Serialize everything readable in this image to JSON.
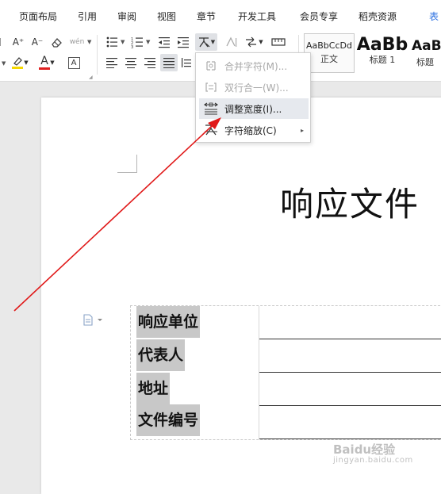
{
  "menu_tabs": [
    "页面布局",
    "引用",
    "审阅",
    "视图",
    "章节",
    "开发工具",
    "会员专享",
    "稻壳资源",
    "表"
  ],
  "ribbon": {
    "font_size_up": "A⁺",
    "font_size_down": "A⁻",
    "phonetic": "wén",
    "font_color_letter": "A",
    "char_border_letter": "A",
    "highlight_color": "#f5d800",
    "font_color": "#e02020",
    "styles": [
      {
        "sample": "AaBbCcDd",
        "name": "正文"
      },
      {
        "sample": "AaBb",
        "name": "标题 1"
      },
      {
        "sample": "AaB",
        "name": "标题"
      }
    ]
  },
  "context_menu": {
    "items": [
      {
        "label": "合并字符(M)...",
        "icon": "merge-chars-icon",
        "disabled": true
      },
      {
        "label": "双行合一(W)...",
        "icon": "two-lines-in-one-icon",
        "disabled": true
      },
      {
        "label": "调整宽度(I)...",
        "icon": "adjust-width-icon",
        "disabled": false
      },
      {
        "label": "字符缩放(C)",
        "icon": "char-scale-icon",
        "disabled": false,
        "submenu_arrow": "▸"
      }
    ]
  },
  "document": {
    "title": "响应文件",
    "fields": [
      "响应单位",
      "代表人",
      "地址",
      "文件编号"
    ]
  },
  "annotation": {
    "color": "#e01818"
  },
  "watermark": {
    "text": "Baidu经验",
    "sub": "jingyan.baidu.com"
  }
}
